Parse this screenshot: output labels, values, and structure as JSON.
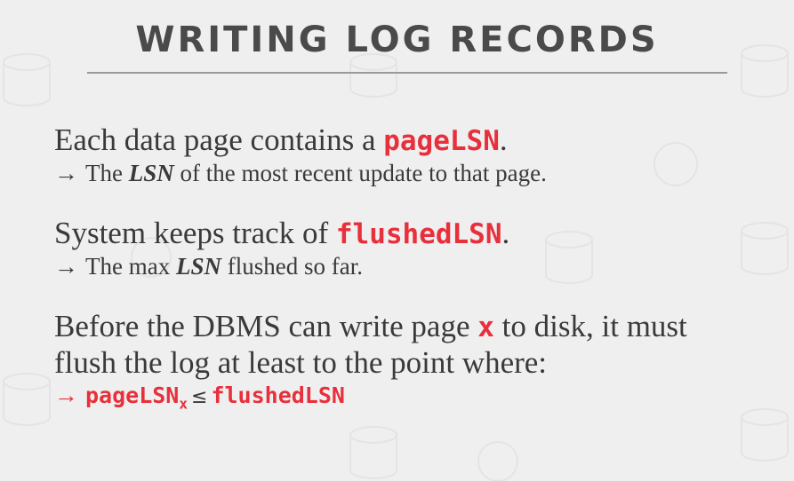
{
  "slide": {
    "title": "WRITING LOG RECORDS"
  },
  "blocks": [
    {
      "main_prefix": "Each data page contains a ",
      "main_code": "pageLSN",
      "main_suffix": ".",
      "sub_arrow": "→",
      "sub_prefix": "The ",
      "sub_em": "LSN",
      "sub_suffix": " of the most recent update to that page."
    },
    {
      "main_prefix": "System keeps track of ",
      "main_code": "flushedLSN",
      "main_suffix": ".",
      "sub_arrow": "→",
      "sub_prefix": "The max ",
      "sub_em": "LSN",
      "sub_suffix": " flushed so far."
    },
    {
      "main_prefix": "Before the DBMS can write page ",
      "main_code": "x",
      "main_suffix": " to disk, it must",
      "main_line2": "flush the log at least to the point where:",
      "sub_arrow": "→",
      "sub_code1": "pageLSN",
      "sub_subscript": "x",
      "sub_op": "≤",
      "sub_code2": "flushedLSN"
    }
  ],
  "colors": {
    "background": "#efefef",
    "title": "#4a4a4a",
    "text": "#3a3a3a",
    "accent_code": "#e8303c",
    "rule": "#9a9a9a"
  }
}
